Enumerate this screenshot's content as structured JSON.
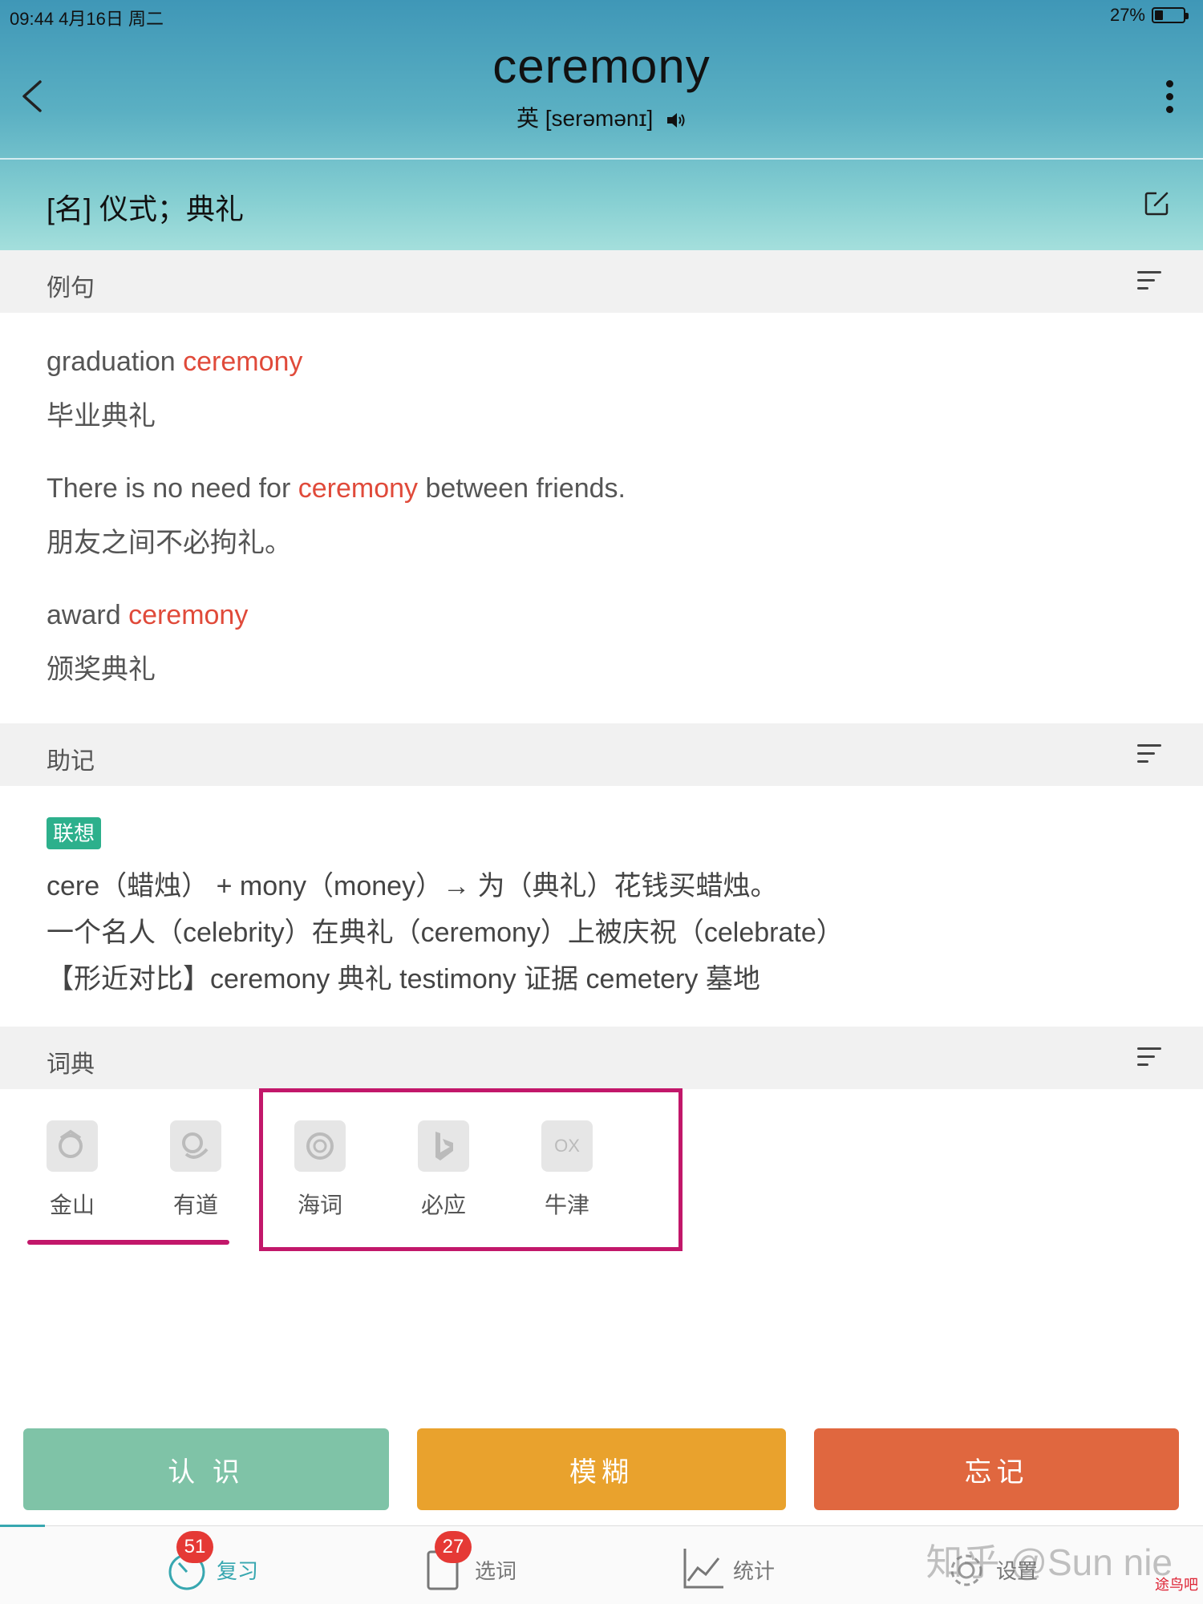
{
  "status": {
    "time": "09:44   4月16日 周二",
    "battery": "27%"
  },
  "header": {
    "word": "ceremony",
    "phonetic": "英 [serəmənɪ]",
    "definition": "[名] 仪式；典礼"
  },
  "examples": {
    "title": "例句",
    "items": [
      {
        "before": "graduation ",
        "highlight": "ceremony",
        "after": "",
        "zh": "毕业典礼"
      },
      {
        "before": "There is no need for ",
        "highlight": "ceremony",
        "after": " between friends.",
        "zh": "朋友之间不必拘礼。"
      },
      {
        "before": "award ",
        "highlight": "ceremony",
        "after": "",
        "zh": "颁奖典礼"
      }
    ]
  },
  "mnemonic": {
    "title": "助记",
    "tag": "联想",
    "lines": [
      "cere（蜡烛） + mony（money）→ 为（典礼）花钱买蜡烛。",
      "一个名人（celebrity）在典礼（ceremony）上被庆祝（celebrate）",
      "【形近对比】ceremony 典礼  testimony 证据   cemetery 墓地"
    ]
  },
  "dictionary": {
    "title": "词典",
    "items": [
      {
        "label": "金山",
        "icon": "jinshan-icon"
      },
      {
        "label": "有道",
        "icon": "youdao-icon"
      },
      {
        "label": "海词",
        "icon": "haici-icon"
      },
      {
        "label": "必应",
        "icon": "bing-icon"
      },
      {
        "label": "牛津",
        "icon": "oxford-icon",
        "icon_text": "OX"
      }
    ]
  },
  "actions": {
    "know": "认 识",
    "vague": "模糊",
    "forget": "忘记"
  },
  "tabs": [
    {
      "label": "复习",
      "badge": "51",
      "color": "#37a7b0"
    },
    {
      "label": "选词",
      "badge": "27",
      "color": "#777777"
    },
    {
      "label": "统计",
      "color": "#777777"
    },
    {
      "label": "设置",
      "color": "#777777"
    }
  ],
  "watermark": "知乎 @Sun nie",
  "watermark_logo": "途鸟吧",
  "colors": {
    "highlight": "#e04a3a",
    "tag": "#2db08c",
    "annotation": "#c2176a",
    "know": "#7fc3a7",
    "vague": "#e9a22d",
    "forget": "#e0673f"
  }
}
